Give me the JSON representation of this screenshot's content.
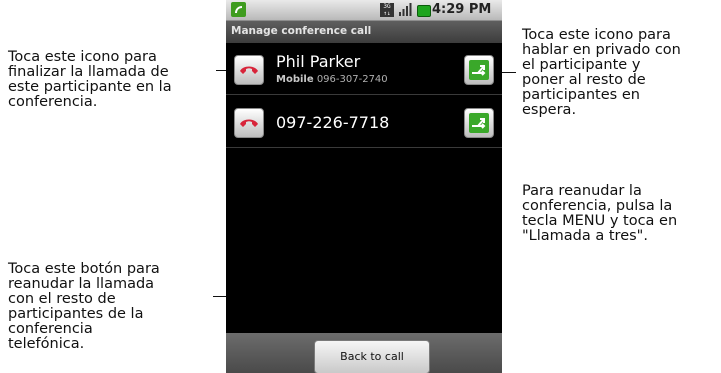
{
  "callouts": {
    "end_call": "Toca este icono para\nfinalizar la llamada de\neste participante en la\nconferencia.",
    "private_talk": "Toca este icono para\nhablar en privado con\nel participante y\nponer al resto de\nparticipantes en\nespera.",
    "resume_conference": "Para reanudar la\nconferencia, pulsa la\ntecla MENU y toca en\n\"Llamada a tres\".",
    "back_to_call": "Toca este botón para\nreanudar la llamada\ncon el resto de\nparticipantes de la\nconferencia\ntelefónica."
  },
  "status_bar": {
    "network_icon": "3g-icon",
    "signal_icon": "signal-icon",
    "battery_icon": "battery-icon",
    "time": "4:29 PM"
  },
  "screen": {
    "title": "Manage conference call",
    "participants": [
      {
        "name": "Phil Parker",
        "label": "Mobile",
        "number": "096-307-2740"
      },
      {
        "number": "097-226-7718"
      }
    ],
    "back_button": "Back to call"
  },
  "colors": {
    "end_call_red": "#d8243a",
    "split_green": "#3aa82a"
  }
}
